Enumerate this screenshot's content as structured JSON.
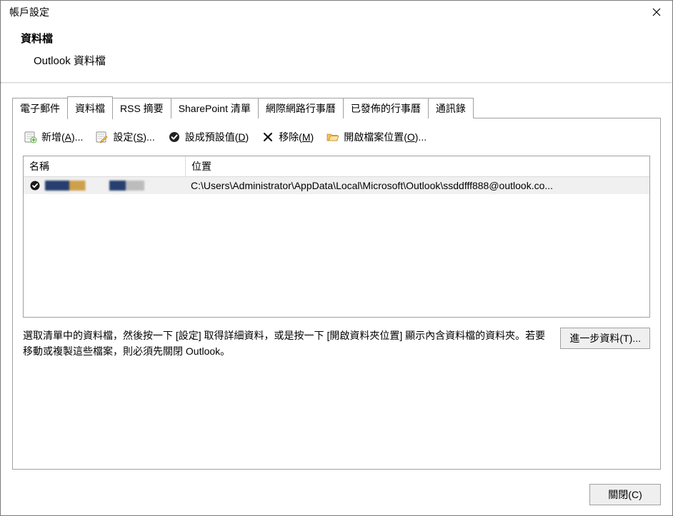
{
  "window": {
    "title": "帳戶設定"
  },
  "header": {
    "h1": "資料檔",
    "h2": "Outlook 資料檔"
  },
  "tabs": [
    {
      "label": "電子郵件",
      "active": false
    },
    {
      "label": "資料檔",
      "active": true
    },
    {
      "label": "RSS 摘要",
      "active": false
    },
    {
      "label": "SharePoint 清單",
      "active": false
    },
    {
      "label": "網際網路行事曆",
      "active": false
    },
    {
      "label": "已發佈的行事曆",
      "active": false
    },
    {
      "label": "通訊錄",
      "active": false
    }
  ],
  "toolbar": {
    "add": {
      "text_pre": "新增(",
      "mnemonic": "A",
      "text_post": ")..."
    },
    "settings": {
      "text_pre": "設定(",
      "mnemonic": "S",
      "text_post": ")..."
    },
    "setdefault": {
      "text_pre": "設成預設值(",
      "mnemonic": "D",
      "text_post": ")"
    },
    "remove": {
      "text_pre": "移除(",
      "mnemonic": "M",
      "text_post": ")"
    },
    "openloc": {
      "text_pre": "開啟檔案位置(",
      "mnemonic": "O",
      "text_post": ")..."
    }
  },
  "columns": {
    "name": "名稱",
    "location": "位置"
  },
  "rows": [
    {
      "name_redacted": true,
      "default": true,
      "location": "C:\\Users\\Administrator\\AppData\\Local\\Microsoft\\Outlook\\ssddfff888@outlook.co..."
    }
  ],
  "help_text": "選取清單中的資料檔，然後按一下 [設定] 取得詳細資料，或是按一下 [開啟資料夾位置] 顯示內含資料檔的資料夾。若要移動或複製這些檔案，則必須先關閉 Outlook。",
  "more_button": {
    "text_pre": "進一步資料(",
    "mnemonic": "T",
    "text_post": ")..."
  },
  "close_button": {
    "text_pre": "關閉(",
    "mnemonic": "C",
    "text_post": ")"
  }
}
